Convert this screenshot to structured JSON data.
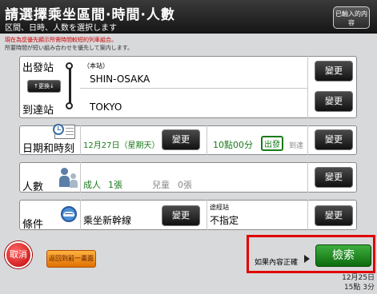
{
  "header": {
    "title": "請選擇乘坐區間·時間·人數",
    "subtitle": "区間、日時、人数を選択します",
    "entered_button": "已輸入的内容"
  },
  "notice": {
    "line1": "現在為您優先顯示所需時間較短的列車組合。",
    "line2": "所要時間が短い組み合わせを優先して案内します。"
  },
  "route": {
    "departure_label": "出發站",
    "arrival_label": "到達站",
    "swap_button": "↑更換↓",
    "departure_note": "（本站）",
    "departure_station": "SHIN-OSAKA",
    "arrival_station": "TOKYO",
    "change_label": "變更"
  },
  "datetime": {
    "label": "日期和時刻",
    "date": "12月27日（星期天）",
    "time": "10點00分",
    "depart_tag": "出發",
    "arrive_tag": "到達",
    "change_label": "變更"
  },
  "people": {
    "label": "人數",
    "adult": "成人",
    "adult_count": "1張",
    "child": "兒童",
    "child_count": "0張",
    "change_label": "變更"
  },
  "conditions": {
    "label": "條件",
    "train_type": "乘坐新幹線",
    "via_label": "途經站",
    "via_value": "不指定",
    "change_label": "變更"
  },
  "footer": {
    "confirm_text": "如果內容正確",
    "search_button": "檢索",
    "cancel_button": "取消",
    "back_button": "返回到前一畫面",
    "date": "12月25日",
    "time": "15點 3分"
  },
  "colors": {
    "accent_green": "#1a7a1a",
    "highlight_red": "#e00000",
    "cancel_red": "#c00000",
    "back_orange": "#e07000"
  }
}
